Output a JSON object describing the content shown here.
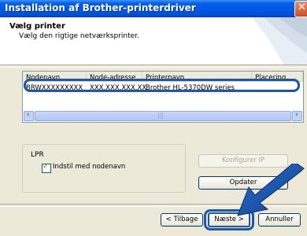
{
  "window": {
    "title": "Installation af Brother-printerdriver"
  },
  "header": {
    "title": "Vælg printer",
    "subtitle": "Vælg den rigtige netværksprinter."
  },
  "list": {
    "columns": [
      "Nodenavn",
      "Node-adresse",
      "Printernavn",
      "Placering"
    ],
    "rows": [
      {
        "node_name": "BRWXXXXXXXXX",
        "node_address": "XXX.XXX.XXX.XX",
        "printer_name": "Brother HL-5370DW series",
        "location": ""
      }
    ],
    "selected_row": 0
  },
  "lpr": {
    "label": "LPR",
    "checkbox_label": "Indstil med nodenavn",
    "checked": true
  },
  "buttons": {
    "configure_ip": "Konfigurer IP",
    "update": "Opdater",
    "back": "< Tilbage",
    "next": "Næste >",
    "cancel": "Annuller"
  },
  "icons": {
    "close": "close-icon",
    "scroll_left": "chevron-left-icon",
    "scroll_right": "chevron-right-icon",
    "checkbox": "check-icon",
    "pointer": "arrow-pointer-icon"
  },
  "colors": {
    "titlebar": "#0058e8",
    "highlight": "#1e56a8",
    "dialog": "#ece9d8"
  }
}
